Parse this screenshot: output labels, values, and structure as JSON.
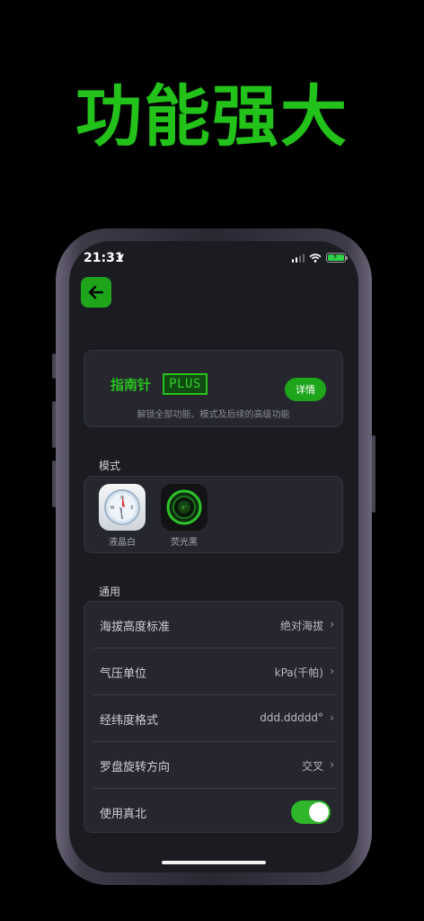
{
  "headline": "功能强大",
  "status_bar": {
    "time": "21:31"
  },
  "plus_card": {
    "title": "指南针",
    "badge": "PLUS",
    "details_button": "详情",
    "subtitle": "解锁全部功能、模式及后续的高级功能"
  },
  "mode_section": {
    "label": "模式",
    "items": [
      {
        "label": "液晶白",
        "icon": "white-compass-icon"
      },
      {
        "label": "荧光黑",
        "icon": "black-compass-icon"
      }
    ]
  },
  "general_section": {
    "label": "通用",
    "rows": [
      {
        "label": "海拔高度标准",
        "value": "绝对海拔"
      },
      {
        "label": "气压单位",
        "value": "kPa(千帕)"
      },
      {
        "label": "经纬度格式",
        "value": "ddd.ddddd°"
      },
      {
        "label": "罗盘旋转方向",
        "value": "交叉"
      },
      {
        "label": "使用真北",
        "toggle_on": true
      }
    ]
  },
  "colors": {
    "accent": "#1fa51c",
    "background": "#000000",
    "card": "#26272e"
  }
}
